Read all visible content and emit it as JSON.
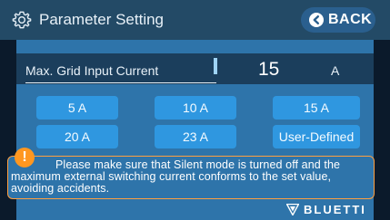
{
  "header": {
    "title": "Parameter Setting",
    "back_label": "BACK"
  },
  "setting": {
    "label": "Max. Grid Input Current",
    "value": "15",
    "unit": "A"
  },
  "options": [
    {
      "label": "5 A"
    },
    {
      "label": "10 A"
    },
    {
      "label": "15 A"
    },
    {
      "label": "20 A"
    },
    {
      "label": "23 A"
    },
    {
      "label": "User-Defined"
    }
  ],
  "warning": {
    "icon": "!",
    "text": "Please make sure that Silent mode is turned off and the maximum external switching current conforms to the set value, avoiding accidents."
  },
  "brand": {
    "name": "BLUETTI"
  },
  "colors": {
    "titlebar": "#234a66",
    "body": "#2e74aa",
    "option_button": "#2f97e0",
    "warning_border": "#ff9f40",
    "warning_icon": "#ff9720"
  },
  "icons": {
    "settings": "gear-icon",
    "back": "back-arrow-icon",
    "warning": "exclamation-icon",
    "brand": "bluetti-logo-icon"
  }
}
